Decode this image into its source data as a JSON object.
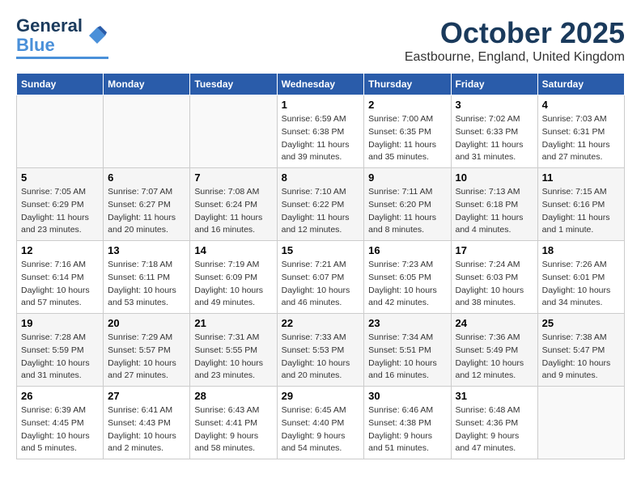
{
  "logo": {
    "line1": "General",
    "line2": "Blue"
  },
  "title": "October 2025",
  "location": "Eastbourne, England, United Kingdom",
  "days_of_week": [
    "Sunday",
    "Monday",
    "Tuesday",
    "Wednesday",
    "Thursday",
    "Friday",
    "Saturday"
  ],
  "weeks": [
    [
      {
        "day": "",
        "info": ""
      },
      {
        "day": "",
        "info": ""
      },
      {
        "day": "",
        "info": ""
      },
      {
        "day": "1",
        "info": "Sunrise: 6:59 AM\nSunset: 6:38 PM\nDaylight: 11 hours\nand 39 minutes."
      },
      {
        "day": "2",
        "info": "Sunrise: 7:00 AM\nSunset: 6:35 PM\nDaylight: 11 hours\nand 35 minutes."
      },
      {
        "day": "3",
        "info": "Sunrise: 7:02 AM\nSunset: 6:33 PM\nDaylight: 11 hours\nand 31 minutes."
      },
      {
        "day": "4",
        "info": "Sunrise: 7:03 AM\nSunset: 6:31 PM\nDaylight: 11 hours\nand 27 minutes."
      }
    ],
    [
      {
        "day": "5",
        "info": "Sunrise: 7:05 AM\nSunset: 6:29 PM\nDaylight: 11 hours\nand 23 minutes."
      },
      {
        "day": "6",
        "info": "Sunrise: 7:07 AM\nSunset: 6:27 PM\nDaylight: 11 hours\nand 20 minutes."
      },
      {
        "day": "7",
        "info": "Sunrise: 7:08 AM\nSunset: 6:24 PM\nDaylight: 11 hours\nand 16 minutes."
      },
      {
        "day": "8",
        "info": "Sunrise: 7:10 AM\nSunset: 6:22 PM\nDaylight: 11 hours\nand 12 minutes."
      },
      {
        "day": "9",
        "info": "Sunrise: 7:11 AM\nSunset: 6:20 PM\nDaylight: 11 hours\nand 8 minutes."
      },
      {
        "day": "10",
        "info": "Sunrise: 7:13 AM\nSunset: 6:18 PM\nDaylight: 11 hours\nand 4 minutes."
      },
      {
        "day": "11",
        "info": "Sunrise: 7:15 AM\nSunset: 6:16 PM\nDaylight: 11 hours\nand 1 minute."
      }
    ],
    [
      {
        "day": "12",
        "info": "Sunrise: 7:16 AM\nSunset: 6:14 PM\nDaylight: 10 hours\nand 57 minutes."
      },
      {
        "day": "13",
        "info": "Sunrise: 7:18 AM\nSunset: 6:11 PM\nDaylight: 10 hours\nand 53 minutes."
      },
      {
        "day": "14",
        "info": "Sunrise: 7:19 AM\nSunset: 6:09 PM\nDaylight: 10 hours\nand 49 minutes."
      },
      {
        "day": "15",
        "info": "Sunrise: 7:21 AM\nSunset: 6:07 PM\nDaylight: 10 hours\nand 46 minutes."
      },
      {
        "day": "16",
        "info": "Sunrise: 7:23 AM\nSunset: 6:05 PM\nDaylight: 10 hours\nand 42 minutes."
      },
      {
        "day": "17",
        "info": "Sunrise: 7:24 AM\nSunset: 6:03 PM\nDaylight: 10 hours\nand 38 minutes."
      },
      {
        "day": "18",
        "info": "Sunrise: 7:26 AM\nSunset: 6:01 PM\nDaylight: 10 hours\nand 34 minutes."
      }
    ],
    [
      {
        "day": "19",
        "info": "Sunrise: 7:28 AM\nSunset: 5:59 PM\nDaylight: 10 hours\nand 31 minutes."
      },
      {
        "day": "20",
        "info": "Sunrise: 7:29 AM\nSunset: 5:57 PM\nDaylight: 10 hours\nand 27 minutes."
      },
      {
        "day": "21",
        "info": "Sunrise: 7:31 AM\nSunset: 5:55 PM\nDaylight: 10 hours\nand 23 minutes."
      },
      {
        "day": "22",
        "info": "Sunrise: 7:33 AM\nSunset: 5:53 PM\nDaylight: 10 hours\nand 20 minutes."
      },
      {
        "day": "23",
        "info": "Sunrise: 7:34 AM\nSunset: 5:51 PM\nDaylight: 10 hours\nand 16 minutes."
      },
      {
        "day": "24",
        "info": "Sunrise: 7:36 AM\nSunset: 5:49 PM\nDaylight: 10 hours\nand 12 minutes."
      },
      {
        "day": "25",
        "info": "Sunrise: 7:38 AM\nSunset: 5:47 PM\nDaylight: 10 hours\nand 9 minutes."
      }
    ],
    [
      {
        "day": "26",
        "info": "Sunrise: 6:39 AM\nSunset: 4:45 PM\nDaylight: 10 hours\nand 5 minutes."
      },
      {
        "day": "27",
        "info": "Sunrise: 6:41 AM\nSunset: 4:43 PM\nDaylight: 10 hours\nand 2 minutes."
      },
      {
        "day": "28",
        "info": "Sunrise: 6:43 AM\nSunset: 4:41 PM\nDaylight: 9 hours\nand 58 minutes."
      },
      {
        "day": "29",
        "info": "Sunrise: 6:45 AM\nSunset: 4:40 PM\nDaylight: 9 hours\nand 54 minutes."
      },
      {
        "day": "30",
        "info": "Sunrise: 6:46 AM\nSunset: 4:38 PM\nDaylight: 9 hours\nand 51 minutes."
      },
      {
        "day": "31",
        "info": "Sunrise: 6:48 AM\nSunset: 4:36 PM\nDaylight: 9 hours\nand 47 minutes."
      },
      {
        "day": "",
        "info": ""
      }
    ]
  ]
}
